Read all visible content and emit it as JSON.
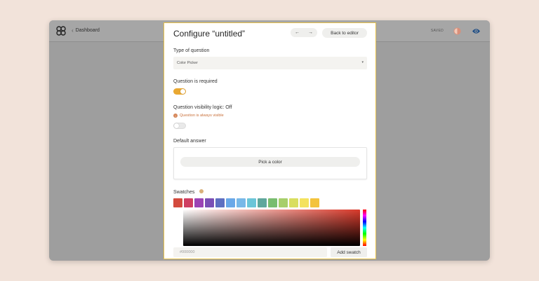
{
  "topbar": {
    "back_label": "Dashboard",
    "saved_label": "SAVED",
    "icons": {
      "logo": "logo-icon",
      "contrast": "contrast-icon",
      "preview": "eye-icon"
    },
    "preview_color": "#1f4e86"
  },
  "modal": {
    "title": "Configure “untitled”",
    "prev_icon": "←",
    "next_icon": "→",
    "back_to_editor": "Back to editor",
    "accent": "#e9a832",
    "question_type": {
      "label": "Type of question",
      "value": "Color Picker"
    },
    "required": {
      "label": "Question is required",
      "enabled": true
    },
    "visibility": {
      "label": "Question visibility logic: Off",
      "warning": "Question is always visible",
      "enabled": false
    },
    "default_answer": {
      "label": "Default answer",
      "button": "Pick a color"
    },
    "swatches": {
      "label": "Swatches",
      "colors": [
        "#d34b3e",
        "#cf3f62",
        "#9b44b5",
        "#7a4fb5",
        "#5e6fc1",
        "#6aa8e8",
        "#78b8e8",
        "#6cc5d8",
        "#5fa79c",
        "#79bd6f",
        "#a7cf6b",
        "#d9de5e",
        "#f4e25e",
        "#f3c33c"
      ],
      "hex_placeholder": "#000000",
      "add_button": "Add swatch"
    }
  }
}
